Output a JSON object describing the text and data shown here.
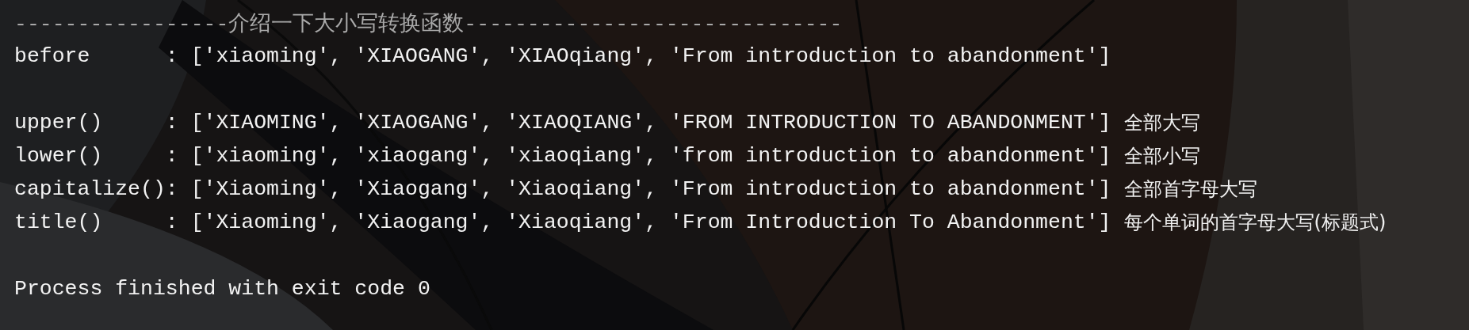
{
  "console": {
    "lines": [
      {
        "kind": "divider",
        "text": "-----------------介绍一下大小写转换函数------------------------------"
      },
      {
        "kind": "output",
        "text": "before      : ['xiaoming', 'XIAOGANG', 'XIAOqiang', 'From introduction to abandonment']"
      },
      {
        "kind": "blank"
      },
      {
        "kind": "output",
        "text": "upper()     : ['XIAOMING', 'XIAOGANG', 'XIAOQIANG', 'FROM INTRODUCTION TO ABANDONMENT']",
        "comment": "全部大写"
      },
      {
        "kind": "output",
        "text": "lower()     : ['xiaoming', 'xiaogang', 'xiaoqiang', 'from introduction to abandonment']",
        "comment": "全部小写"
      },
      {
        "kind": "output",
        "text": "capitalize(): ['Xiaoming', 'Xiaogang', 'Xiaoqiang', 'From introduction to abandonment']",
        "comment": "全部首字母大写"
      },
      {
        "kind": "output",
        "text": "title()     : ['Xiaoming', 'Xiaogang', 'Xiaoqiang', 'From Introduction To Abandonment']",
        "comment": "每个单词的首字母大写(标题式)"
      },
      {
        "kind": "blank"
      },
      {
        "kind": "output",
        "text": "Process finished with exit code 0"
      }
    ]
  }
}
